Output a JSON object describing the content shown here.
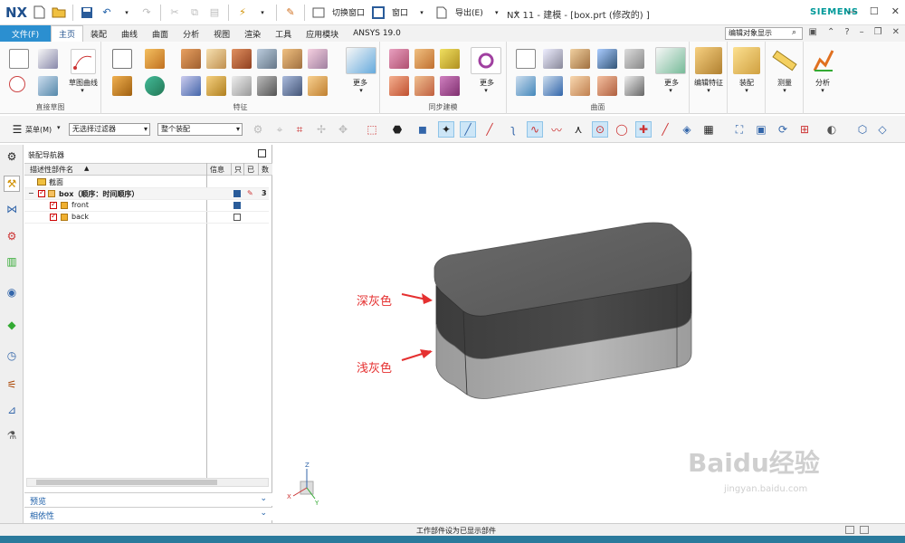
{
  "app": {
    "logo": "NX",
    "window_title": "NX 11 - 建模 - [box.prt  (修改的) ]",
    "brand": "SIEMENS"
  },
  "quick_access": {
    "switch_window": "切换窗口",
    "window": "窗口",
    "export": "导出(E)"
  },
  "menu": {
    "file": "文件(F)",
    "tabs": [
      "主页",
      "装配",
      "曲线",
      "曲面",
      "分析",
      "视图",
      "渲染",
      "工具",
      "应用模块",
      "ANSYS 19.0"
    ],
    "active_index": 0,
    "command_search_placeholder": "编辑对象显示"
  },
  "ribbon": {
    "groups": [
      {
        "label": "直接草图"
      },
      {
        "label": "特征"
      },
      {
        "label": "同步建模"
      },
      {
        "label": "曲面"
      }
    ],
    "sketch_curve": "草图曲线",
    "more": "更多",
    "edit_feature": "编辑特征",
    "assembly": "装配",
    "measure": "测量",
    "analysis": "分析"
  },
  "toolbar": {
    "menu_button": "菜单(M)",
    "filter_combo": "无选择过滤器",
    "scope_combo": "整个装配"
  },
  "navigator": {
    "title": "装配导航器",
    "columns": {
      "name": "描述性部件名",
      "info": "信息",
      "readonly": "只",
      "modified": "已",
      "count": "数"
    },
    "rows": [
      {
        "name": "截面",
        "level": 1
      },
      {
        "name": "box（顺序：时间顺序）",
        "level": 0,
        "count": "3"
      },
      {
        "name": "front",
        "level": 2
      },
      {
        "name": "back",
        "level": 2
      }
    ],
    "preview": "预览",
    "dependency": "相依性"
  },
  "viewport": {
    "callout_dark": "深灰色",
    "callout_light": "浅灰色"
  },
  "status": {
    "text": "工作部件设为已显示部件"
  },
  "watermark": {
    "main": "Baidu经验",
    "sub": "jingyan.baidu.com"
  },
  "colors": {
    "accent": "#2b8fd0",
    "dark_gray": "#4a4a4a",
    "light_gray": "#a8a8a8",
    "callout": "#e53030"
  }
}
